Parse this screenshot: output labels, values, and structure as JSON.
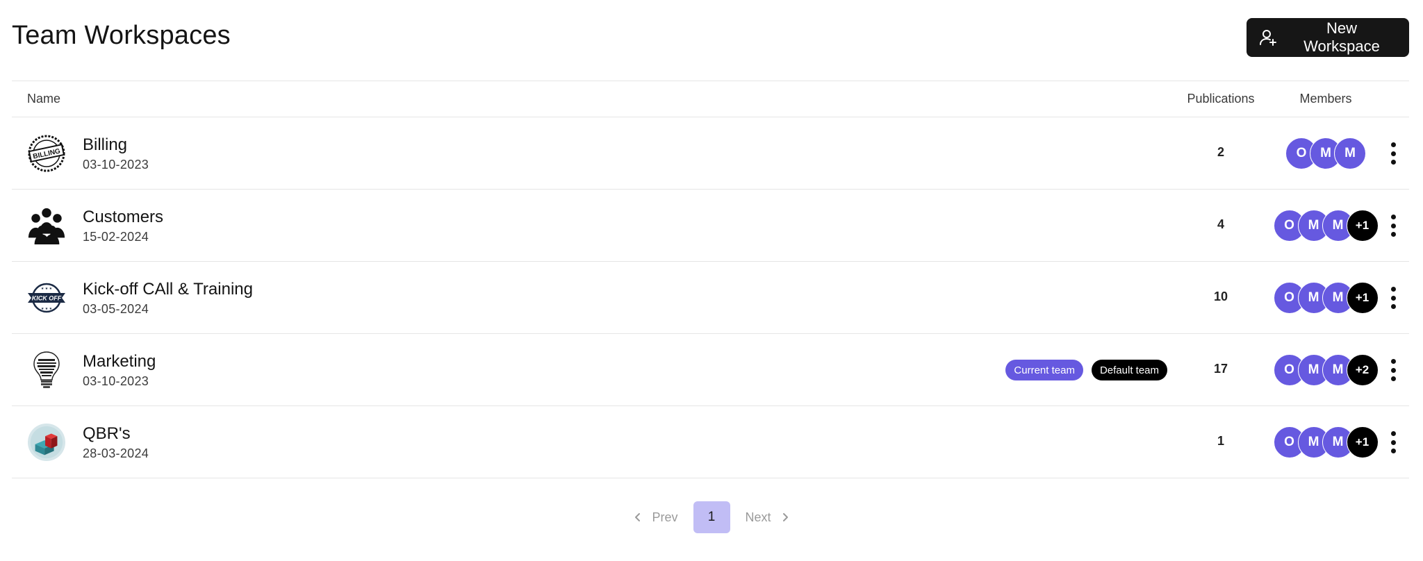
{
  "page": {
    "title": "Team Workspaces"
  },
  "toolbar": {
    "new_label": "New Workspace",
    "new_icon": "user-plus-icon"
  },
  "table": {
    "columns": {
      "name": "Name",
      "publications": "Publications",
      "members": "Members"
    },
    "rows": [
      {
        "name": "Billing",
        "date": "03-10-2023",
        "logo": "billing-stamp-logo",
        "logo_text": "BILLING",
        "publications": "2",
        "badges": [],
        "avatars": [
          "O",
          "M",
          "M"
        ],
        "more": ""
      },
      {
        "name": "Customers",
        "date": "15-02-2024",
        "logo": "people-group-logo",
        "publications": "4",
        "badges": [],
        "avatars": [
          "O",
          "M",
          "M"
        ],
        "more": "+1"
      },
      {
        "name": "Kick-off CAll & Training",
        "date": "03-05-2024",
        "logo": "kick-off-ribbon-logo",
        "logo_text": "KICK OFF",
        "publications": "10",
        "badges": [],
        "avatars": [
          "O",
          "M",
          "M"
        ],
        "more": "+1"
      },
      {
        "name": "Marketing",
        "date": "03-10-2023",
        "logo": "lightbulb-wordcloud-logo",
        "publications": "17",
        "badges": [
          {
            "label": "Current team",
            "kind": "current"
          },
          {
            "label": "Default team",
            "kind": "default"
          }
        ],
        "avatars": [
          "O",
          "M",
          "M"
        ],
        "more": "+2"
      },
      {
        "name": "QBR's",
        "date": "28-03-2024",
        "logo": "cube-chart-logo",
        "publications": "1",
        "badges": [],
        "avatars": [
          "O",
          "M",
          "M"
        ],
        "more": "+1"
      }
    ]
  },
  "pagination": {
    "prev": "Prev",
    "current": "1",
    "next": "Next"
  },
  "colors": {
    "accent": "#6659e0",
    "accent_light": "#c1bdf5",
    "dark": "#161616",
    "more_badge": "#000000"
  }
}
